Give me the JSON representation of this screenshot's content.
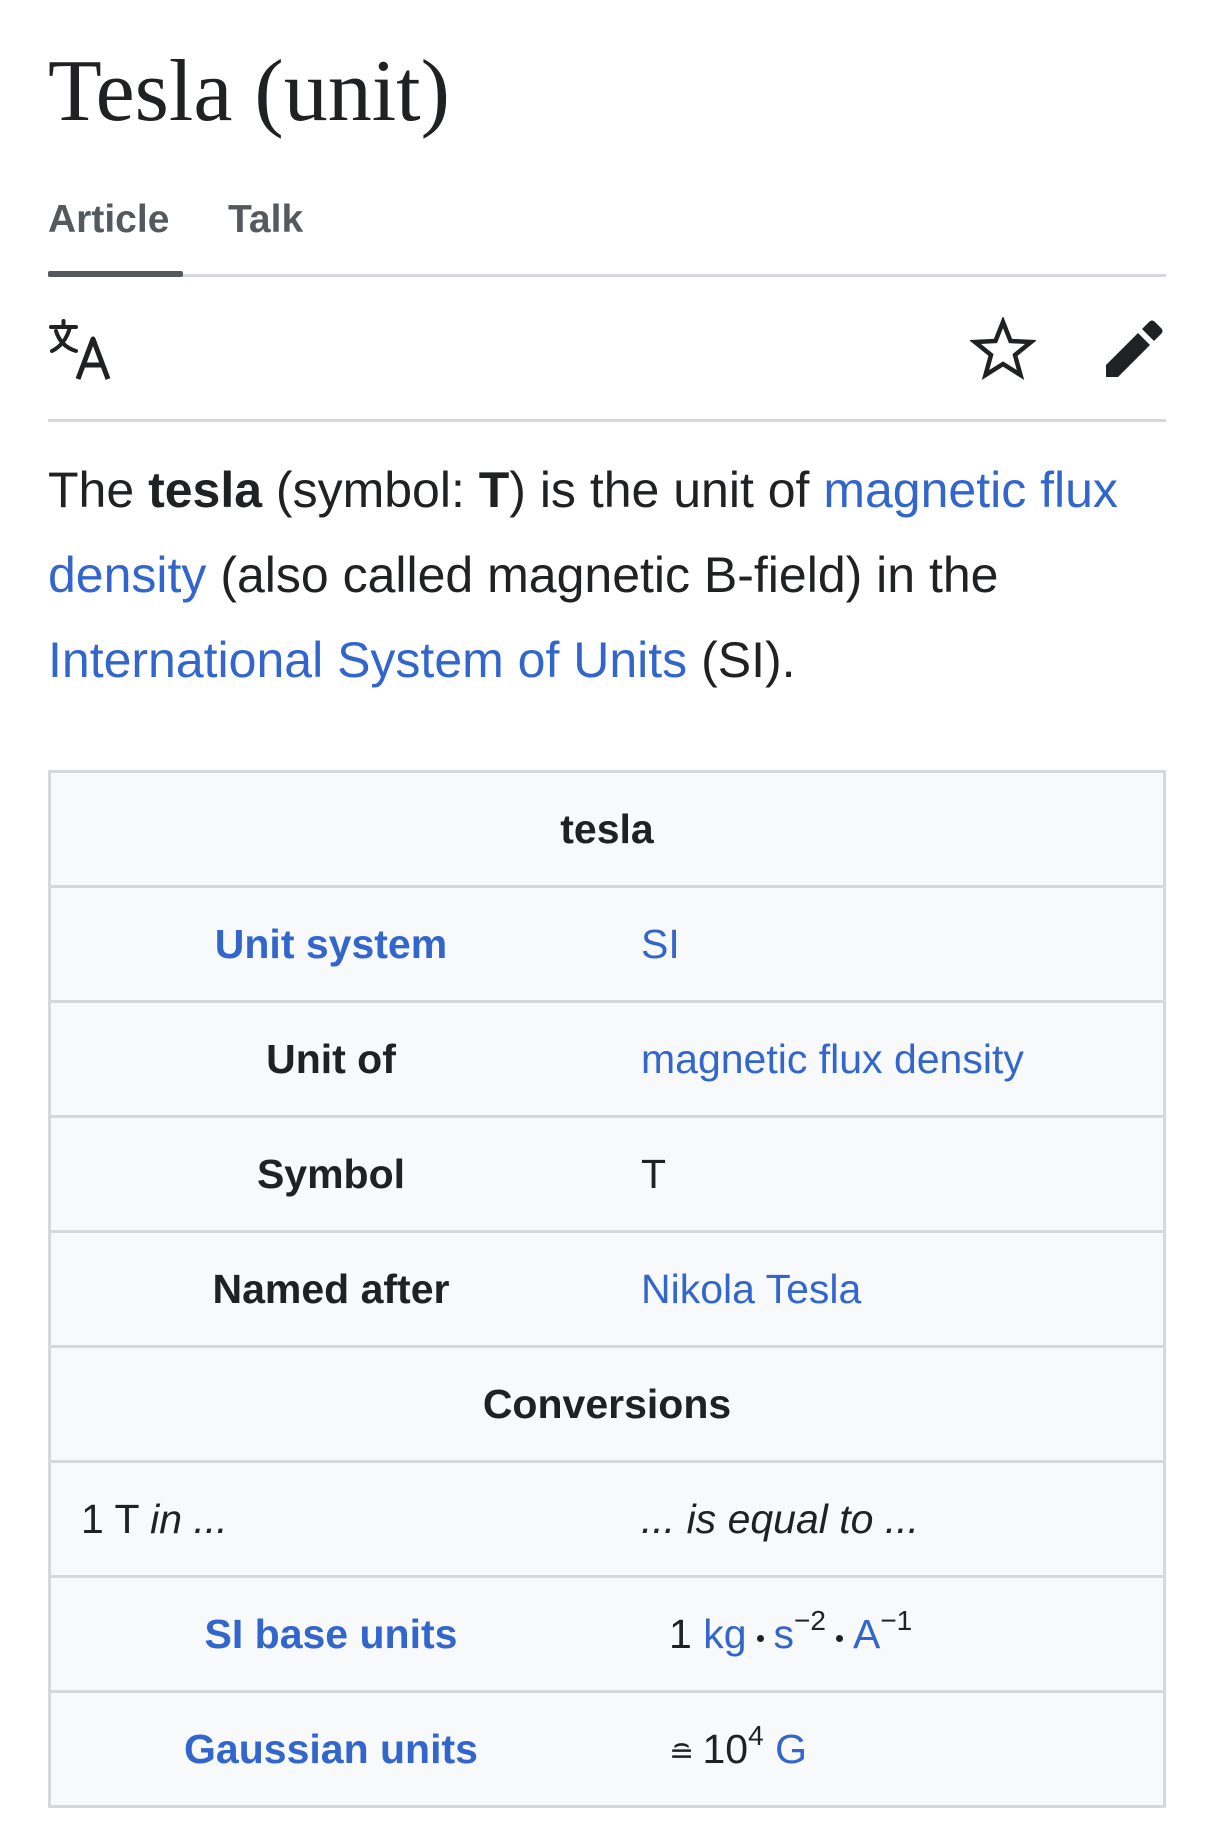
{
  "page": {
    "title": "Tesla (unit)"
  },
  "tabs": {
    "article": "Article",
    "talk": "Talk"
  },
  "intro": {
    "p1": "The ",
    "term": "tesla",
    "p2": " (symbol: ",
    "symbol": "T",
    "p3": ") is the unit of ",
    "link1": "magnetic flux density",
    "p4": " (also called magnetic B-field) in the ",
    "link2": "International System of Units",
    "p5": " (SI)."
  },
  "infobox": {
    "header": "tesla",
    "rows": [
      {
        "label": "Unit system",
        "value": "SI"
      },
      {
        "label": "Unit of",
        "value": "magnetic flux density"
      },
      {
        "label": "Symbol",
        "value": "T"
      },
      {
        "label": "Named after",
        "value": "Nikola Tesla"
      }
    ],
    "conversions_header": "Conversions",
    "conv_left": "1 T ",
    "conv_left_italic": "in ...",
    "conv_right": "... is equal to ...",
    "si_base_label": "SI base units",
    "si_base_value": {
      "coef": "1 ",
      "kg": "kg",
      "s": "s",
      "s_exp": "−2",
      "a": "A",
      "a_exp": "−1"
    },
    "gaussian_label": "Gaussian units",
    "gaussian_value": {
      "corresponds": "≘ ",
      "base": "10",
      "exp": "4",
      "unit": "G"
    }
  },
  "icons": {
    "language": "language-icon",
    "watch": "star-icon",
    "edit": "pencil-icon"
  },
  "colors": {
    "link": "#3366cc",
    "text": "#202122",
    "border": "#d6d8db",
    "infobox_bg": "#f8f9fa"
  }
}
